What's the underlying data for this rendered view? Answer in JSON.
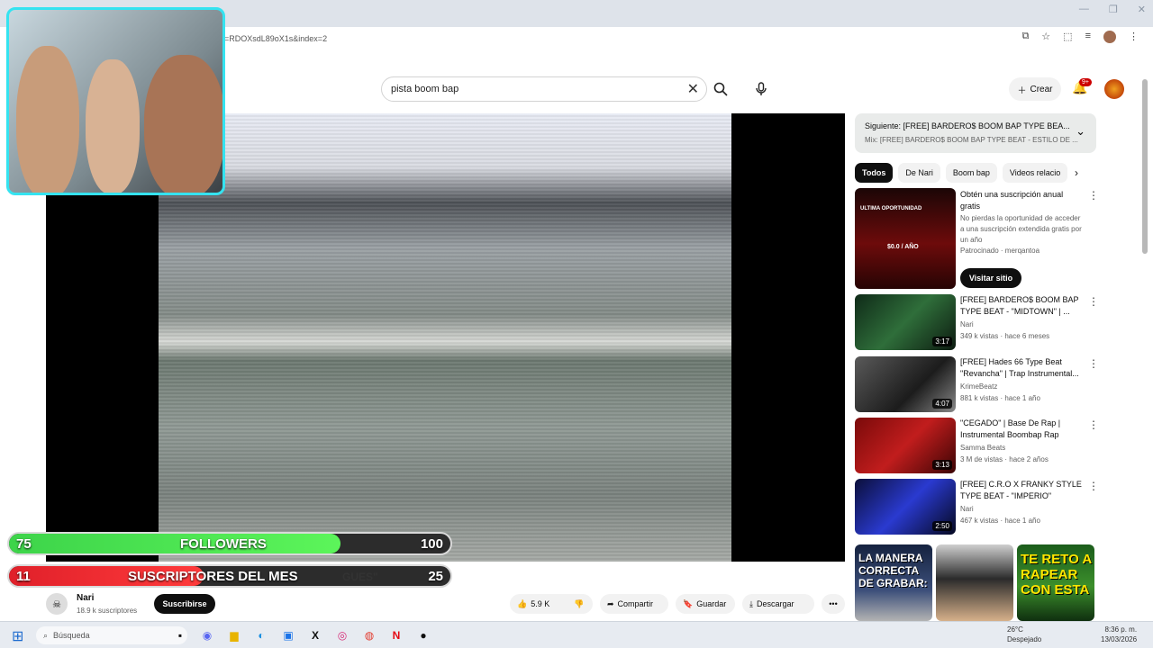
{
  "browser": {
    "url": "ist=RDOXsdL89oX1s&index=2",
    "window_controls": [
      "—",
      "❐",
      "✕"
    ]
  },
  "header": {
    "search_query": "pista boom bap",
    "create_label": "Crear",
    "notif_count": "9+"
  },
  "overlay": {
    "followers": {
      "current": "75",
      "label": "FOLLOWERS",
      "goal": "100",
      "progress": 0.75
    },
    "subs": {
      "current": "11",
      "label": "SUSCRIPTORES DEL MES",
      "goal": "25",
      "progress": 0.44
    }
  },
  "video": {
    "title_fragment": "GUES\"",
    "channel": "Nari",
    "subscribers": "18.9 k suscriptores",
    "subscribe_label": "Suscribirse",
    "likes": "5.9 K",
    "share_label": "Compartir",
    "save_label": "Guardar",
    "download_label": "Descargar"
  },
  "playlist": {
    "next": "Siguiente: [FREE] BARDERO$ BOOM BAP TYPE BEA...",
    "mix": "Mix: [FREE] BARDERO$ BOOM BAP TYPE BEAT - ESTILO DE ..."
  },
  "chips": [
    "Todos",
    "De Nari",
    "Boom bap",
    "Videos relacio"
  ],
  "ad": {
    "title": "Obtén una suscripción anual gratis",
    "desc": "No pierdas la oportunidad de acceder a una suscripción extendida gratis por un año",
    "sponsor": "Patrocinado · merqantoa",
    "visit_label": "Visitar sitio",
    "thumb_text": "ULTIMA OPORTUNIDAD",
    "thumb_price": "$0.0 / AÑO"
  },
  "related": [
    {
      "title": "[FREE] BARDERO$ BOOM BAP TYPE BEAT - \"MIDTOWN\" | ...",
      "channel": "Nari",
      "meta": "349 k vistas · hace 6 meses",
      "duration": "3:17"
    },
    {
      "title": "[FREE] Hades 66 Type Beat \"Revancha\" | Trap Instrumental...",
      "channel": "KrimeBeatz",
      "meta": "881 k vistas · hace 1 año",
      "duration": "4:07"
    },
    {
      "title": "\"CEGADO\" | Base De Rap | Instrumental Boombap Rap",
      "channel": "Samma Beats",
      "meta": "3 M de vistas · hace 2 años",
      "duration": "3:13"
    },
    {
      "title": "[FREE] C.R.O X FRANKY STYLE TYPE BEAT - \"IMPERIO\"",
      "channel": "Nari",
      "meta": "467 k vistas · hace 1 año",
      "duration": "2:50"
    }
  ],
  "shorts": [
    {
      "text": "LA MANERA CORRECTA DE GRABAR:"
    },
    {
      "text": ""
    },
    {
      "text": "TE RETO A RAPEAR CON ESTA"
    }
  ],
  "taskbar": {
    "search_placeholder": "Búsqueda",
    "temp": "26°C",
    "weather": "Despejado",
    "time": "8:36 p. m.",
    "date": "13/03/2026"
  }
}
